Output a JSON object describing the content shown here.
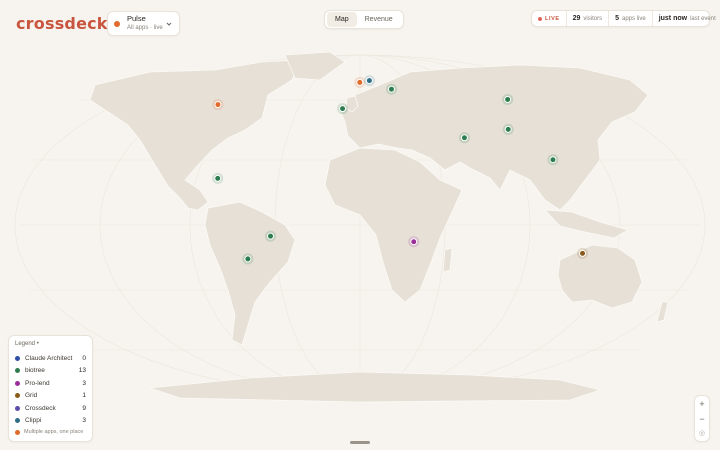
{
  "brand": "crossdeck",
  "app_switcher": {
    "title": "Pulse",
    "subtitle": "All apps · live",
    "dot_color": "#e06b2c"
  },
  "view_tabs": [
    {
      "label": "Map",
      "active": true
    },
    {
      "label": "Revenue",
      "active": false
    }
  ],
  "stats": {
    "live_label": "LIVE",
    "visitors_value": "29",
    "visitors_label": "visitors",
    "apps_value": "5",
    "apps_label": "apps live",
    "last_value": "just now",
    "last_label": "last event"
  },
  "legend": {
    "title": "Legend •",
    "items": [
      {
        "name": "Claude Architect",
        "count": "0",
        "color": "#2f4ea8"
      },
      {
        "name": "biotree",
        "count": "13",
        "color": "#2e7d4f"
      },
      {
        "name": "Pro-lend",
        "count": "3",
        "color": "#9b2f9a"
      },
      {
        "name": "Grid",
        "count": "1",
        "color": "#8a5a1a"
      },
      {
        "name": "Crossdeck",
        "count": "9",
        "color": "#5a4ea8"
      },
      {
        "name": "Clippi",
        "count": "3",
        "color": "#2f6e86"
      }
    ],
    "footer": "Multiple apps, one place",
    "footer_color": "#e06b2c"
  },
  "zoom": {
    "in": "+",
    "out": "−",
    "reset": "◎"
  },
  "markers": [
    {
      "app": "Crossdeck",
      "color": "#e06b2c",
      "lat": 51.5,
      "lon": -0.1
    },
    {
      "app": "Clippi",
      "color": "#2f6e86",
      "lat": 52.4,
      "lon": 4.9
    },
    {
      "app": "biotree",
      "color": "#2e7d4f",
      "lat": 48.2,
      "lon": 16.4
    },
    {
      "app": "biotree",
      "color": "#2e7d4f",
      "lat": 38.7,
      "lon": -9.1
    },
    {
      "app": "Crossdeck",
      "color": "#e06b2c",
      "lat": 40.7,
      "lon": -74.0
    },
    {
      "app": "biotree",
      "color": "#2e7d4f",
      "lat": 43.2,
      "lon": 76.9
    },
    {
      "app": "biotree",
      "color": "#2e7d4f",
      "lat": 28.6,
      "lon": 77.2
    },
    {
      "app": "biotree",
      "color": "#2e7d4f",
      "lat": 24.5,
      "lon": 54.4
    },
    {
      "app": "biotree",
      "color": "#2e7d4f",
      "lat": 13.8,
      "lon": 100.5
    },
    {
      "app": "biotree",
      "color": "#2e7d4f",
      "lat": 4.7,
      "lon": -74.1
    },
    {
      "app": "biotree",
      "color": "#2e7d4f",
      "lat": -23.5,
      "lon": -46.6
    },
    {
      "app": "biotree",
      "color": "#2e7d4f",
      "lat": -34.6,
      "lon": -58.4
    },
    {
      "app": "Pro-lend",
      "color": "#9b2f9a",
      "lat": -26.2,
      "lon": 28.0
    },
    {
      "app": "Grid",
      "color": "#8a5a1a",
      "lat": -31.9,
      "lon": 115.9
    }
  ]
}
